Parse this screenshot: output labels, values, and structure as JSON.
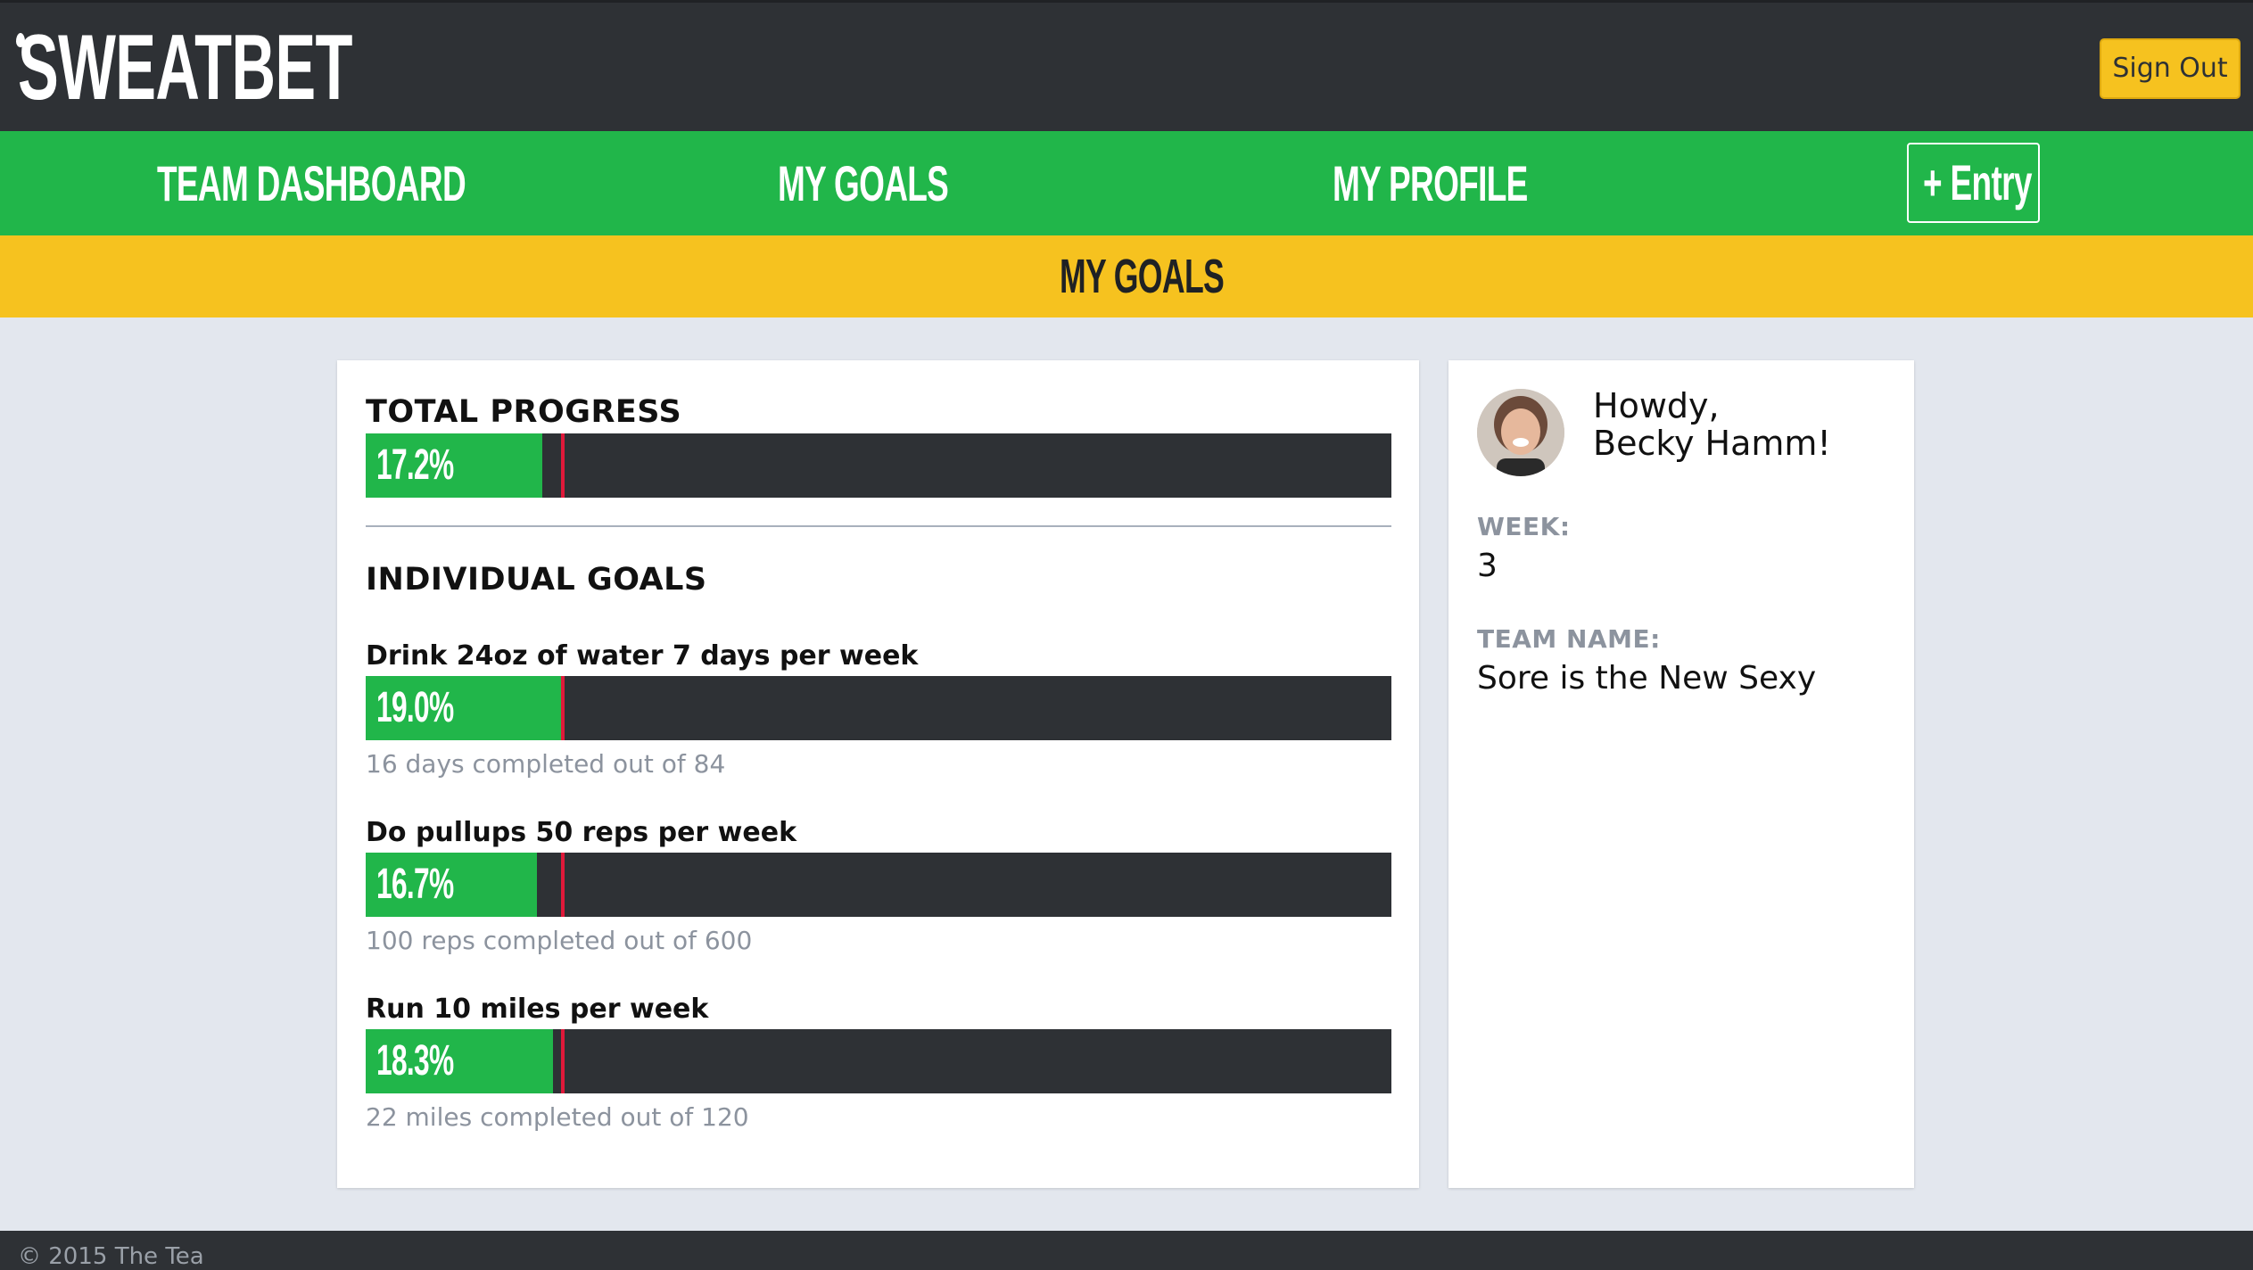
{
  "app": {
    "logo_text": "SWEATBET",
    "sign_out_label": "Sign Out"
  },
  "nav": {
    "items": [
      {
        "label": "TEAM DASHBOARD"
      },
      {
        "label": "MY GOALS"
      },
      {
        "label": "MY PROFILE"
      }
    ],
    "entry_label": "+ Entry"
  },
  "page": {
    "title": "MY GOALS"
  },
  "colors": {
    "header_bg": "#2e3135",
    "nav_green": "#21b64a",
    "accent_yellow": "#f6c21f",
    "marker_red": "#e0193a",
    "page_bg": "#e3e7ee"
  },
  "goals_card": {
    "total_title": "TOTAL PROGRESS",
    "total": {
      "percent_label": "17.2%",
      "progress": 0.172,
      "week_marker": 0.19
    },
    "individual_title": "INDIVIDUAL GOALS",
    "goals": [
      {
        "title": "Drink 24oz of water 7 days per week",
        "percent_label": "19.0%",
        "progress": 0.19,
        "week_marker": 0.19,
        "subtitle": "16 days completed out of 84"
      },
      {
        "title": "Do pullups 50 reps per week",
        "percent_label": "16.7%",
        "progress": 0.167,
        "week_marker": 0.19,
        "subtitle": "100 reps completed out of 600"
      },
      {
        "title": "Run 10 miles per week",
        "percent_label": "18.3%",
        "progress": 0.183,
        "week_marker": 0.19,
        "subtitle": "22 miles completed out of 120"
      }
    ]
  },
  "profile": {
    "greeting_line1": "Howdy,",
    "greeting_line2": "Becky Hamm!",
    "week_label": "WEEK:",
    "week_value": "3",
    "team_label": "TEAM NAME:",
    "team_value": "Sore is the New Sexy"
  },
  "footer": {
    "text": "© 2015 The Tea"
  }
}
